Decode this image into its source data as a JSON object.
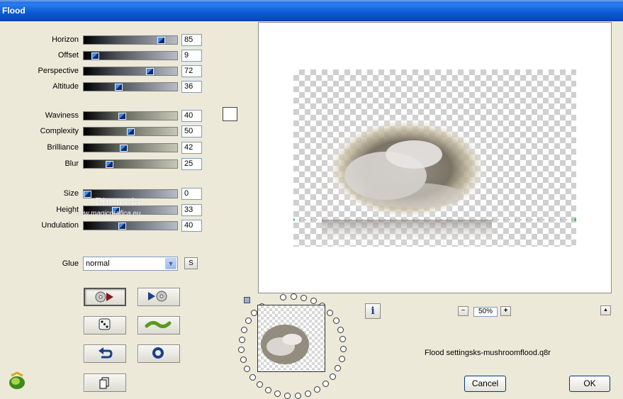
{
  "window": {
    "title": "Flood"
  },
  "sliders_group1": [
    {
      "label": "Horizon",
      "value": "85",
      "pct": 0.85
    },
    {
      "label": "Offset",
      "value": "9",
      "pct": 0.09
    },
    {
      "label": "Perspective",
      "value": "72",
      "pct": 0.72
    },
    {
      "label": "Altitude",
      "value": "36",
      "pct": 0.36
    }
  ],
  "sliders_group2": [
    {
      "label": "Waviness",
      "value": "40",
      "pct": 0.4
    },
    {
      "label": "Complexity",
      "value": "50",
      "pct": 0.5
    },
    {
      "label": "Brilliance",
      "value": "42",
      "pct": 0.42
    },
    {
      "label": "Blur",
      "value": "25",
      "pct": 0.25
    }
  ],
  "sliders_group3": [
    {
      "label": "Size",
      "value": "0",
      "pct": 0.0
    },
    {
      "label": "Height",
      "value": "33",
      "pct": 0.33
    },
    {
      "label": "Undulation",
      "value": "40",
      "pct": 0.4
    }
  ],
  "glue": {
    "label": "Glue",
    "selected": "normal",
    "s_button": "S"
  },
  "watermark": {
    "line1": "Pinuccia",
    "line2": "www.magicgrafica.eu"
  },
  "zoom": {
    "value": "50%",
    "minus": "−",
    "plus": "+"
  },
  "up_button": "▲",
  "info_button": "i",
  "settings_file": "Flood settingsks-mushroomflood.q8r",
  "buttons": {
    "cancel": "Cancel",
    "ok": "OK"
  },
  "colors": {
    "titlebar": "#0b5ad2",
    "dialog_bg": "#ece9d8",
    "slider_thumb": "#0c2a6e"
  }
}
